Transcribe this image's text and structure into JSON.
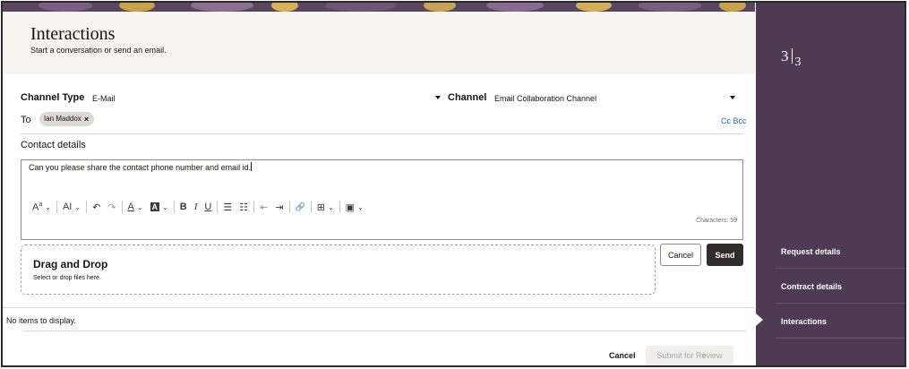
{
  "header": {
    "title": "Interactions",
    "subtitle": "Start a conversation or send an email."
  },
  "sidebar": {
    "step_current": "3",
    "step_total": "3",
    "items": [
      {
        "label": "Request details"
      },
      {
        "label": "Contract details"
      },
      {
        "label": "Interactions"
      }
    ]
  },
  "form": {
    "channel_type_label": "Channel Type",
    "channel_type_value": "E-Mail",
    "channel_label": "Channel",
    "channel_value": "Email Collaboration Channel",
    "to_label": "To",
    "recipient": "Ian Maddox",
    "remove_glyph": "×",
    "cc_bcc": "Cc Bcc",
    "contact_details_label": "Contact details",
    "message_body": "Can you please share the contact phone number and email id.",
    "characters": "Characters: 59"
  },
  "toolbar": {
    "font_size": "A",
    "font_size_sup": "a",
    "text_style": "AI",
    "undo": "↶",
    "redo": "↷",
    "font_color": "A",
    "bg_color": "A",
    "bold": "B",
    "italic": "I",
    "underline": "U",
    "bullets": "☰",
    "numbered": "☷",
    "outdent": "⇤",
    "indent": "⇥",
    "link": "🔗",
    "table": "⊞",
    "image": "▣",
    "dropdown": "⌄"
  },
  "dropzone": {
    "title": "Drag and Drop",
    "subtitle": "Select or drop files here."
  },
  "buttons": {
    "cancel": "Cancel",
    "send": "Send"
  },
  "list": {
    "empty": "No items to display."
  },
  "footer": {
    "cancel": "Cancel",
    "submit": "Submit for Review"
  },
  "colors": {
    "sidebar_bg": "#4e3a52",
    "header_bg": "#f7f5f2",
    "send_bg": "#312d2a",
    "link": "#2b6aa8"
  }
}
